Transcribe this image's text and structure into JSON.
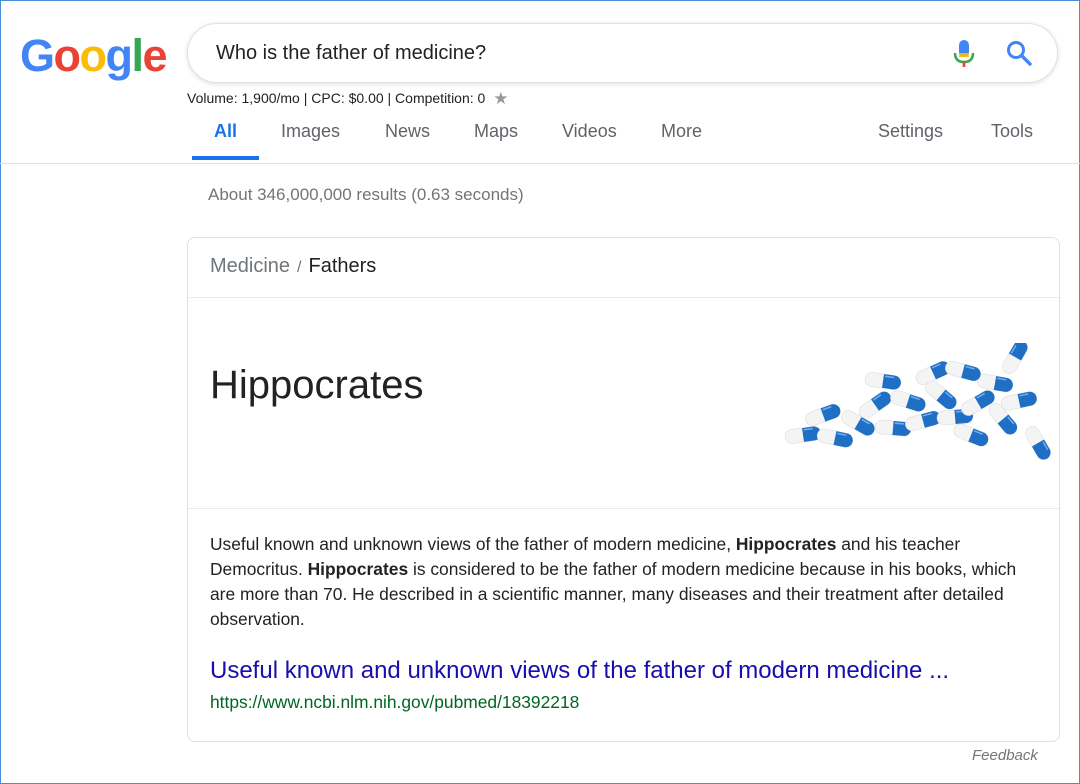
{
  "logo": {
    "letters": [
      "G",
      "o",
      "o",
      "g",
      "l",
      "e"
    ]
  },
  "search": {
    "query": "Who is the father of medicine?"
  },
  "keyword_stats": {
    "text": "Volume: 1,900/mo | CPC: $0.00 | Competition: 0",
    "star": "★"
  },
  "tabs": {
    "all": "All",
    "images": "Images",
    "news": "News",
    "maps": "Maps",
    "videos": "Videos",
    "more": "More",
    "settings": "Settings",
    "tools": "Tools"
  },
  "result_stats": "About 346,000,000 results (0.63 seconds)",
  "snippet": {
    "breadcrumb": {
      "parent": "Medicine",
      "separator": "/",
      "current": "Fathers"
    },
    "answer": "Hippocrates",
    "description": {
      "p1": "Useful known and unknown views of the father of modern medicine, ",
      "b1": "Hippocrates",
      "p2": " and his teacher Democritus. ",
      "b2": "Hippocrates",
      "p3": " is considered to be the father of modern medicine because in his books, which are more than 70. He described in a scientific manner, many diseases and their treatment after detailed observation."
    },
    "link_title": "Useful known and unknown views of the father of modern medicine ...",
    "url": "https://www.ncbi.nlm.nih.gov/pubmed/18392218"
  },
  "feedback": "Feedback",
  "colors": {
    "accent": "#1a73e8",
    "link": "#1a0dab",
    "url": "#006621",
    "google_blue": "#4285f4",
    "google_red": "#ea4335",
    "google_yellow": "#fbbc05",
    "google_green": "#34a853"
  }
}
